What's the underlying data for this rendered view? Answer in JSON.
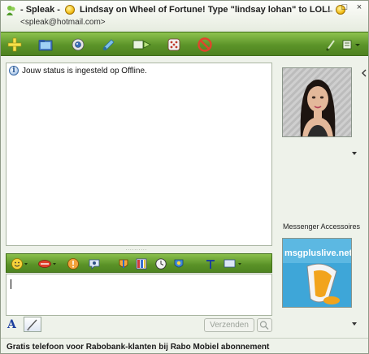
{
  "window": {
    "title_name": "- Spleak -",
    "title_message": "Lindsay on Wheel of Fortune! Type \"lindsay lohan\" to LOL!",
    "email": "<spleak@hotmail.com>",
    "controls": {
      "minimize": "_",
      "maximize": "□",
      "close": "×"
    }
  },
  "toolbar": {
    "buttons": [
      "invite-contact",
      "send-files",
      "webcam",
      "audio",
      "activities",
      "games",
      "block"
    ],
    "right_buttons": [
      "paint-tool",
      "menu"
    ]
  },
  "conversation": {
    "status_message": "Jouw status is ingesteld op Offline."
  },
  "splitter": "..........",
  "format_bar": {
    "buttons": [
      "emoticon",
      "voice-clip",
      "nudge",
      "wink",
      "background",
      "media",
      "history",
      "background-image",
      "font",
      "more"
    ]
  },
  "input": {
    "value": ""
  },
  "bottom": {
    "font_label": "A",
    "send_label": "Verzenden"
  },
  "sidebar": {
    "accessories_label": "Messenger Accessoires",
    "accessories_banner": "msgpluslive.net"
  },
  "footer": {
    "ad_text": "Gratis telefoon voor Rabobank-klanten bij Rabo Mobiel abonnement"
  },
  "colors": {
    "toolbar_green": "#5c9429",
    "window_bg": "#eef2ea",
    "accent_blue": "#4aa9d6"
  }
}
